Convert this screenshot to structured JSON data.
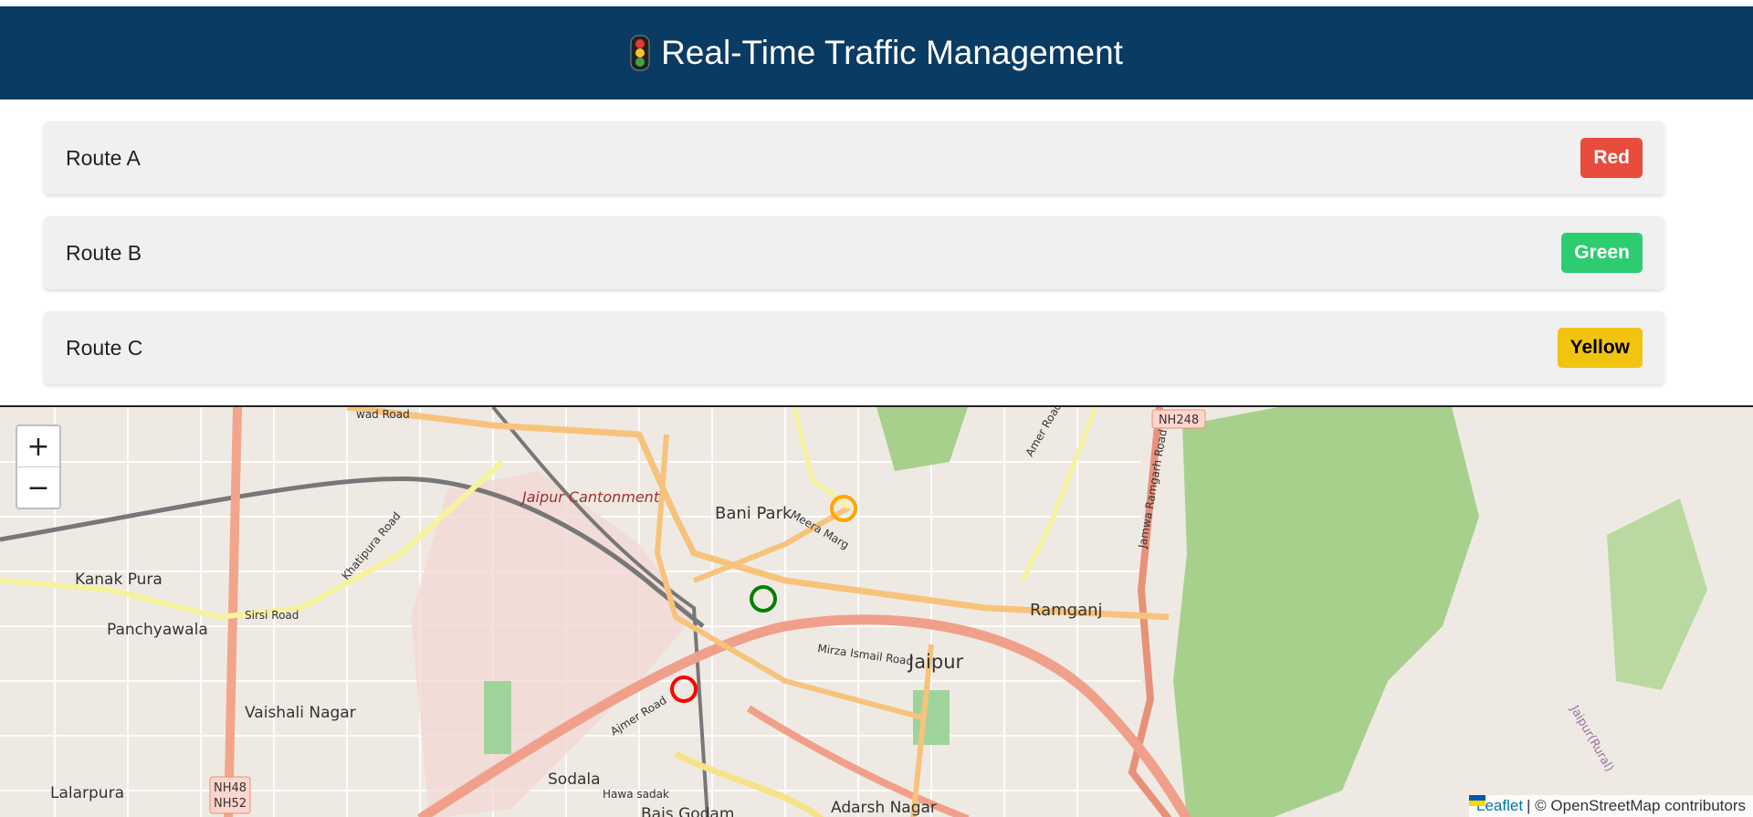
{
  "header": {
    "title": "Real-Time Traffic Management",
    "icon": "traffic-light-icon"
  },
  "routes": [
    {
      "name": "Route A",
      "status": "Red",
      "status_color": "#e74c3c"
    },
    {
      "name": "Route B",
      "status": "Green",
      "status_color": "#2ecc71"
    },
    {
      "name": "Route C",
      "status": "Yellow",
      "status_color": "#f1c40f"
    }
  ],
  "map": {
    "zoom_in": "+",
    "zoom_out": "−",
    "attribution_link": "Leaflet",
    "attribution_text": "| © OpenStreetMap contributors",
    "labels": {
      "bani_park": "Bani Park",
      "jaipur_cantonment": "Jaipur Cantonment",
      "kanak_pura": "Kanak Pura",
      "panchyawala": "Panchyawala",
      "vaishali_nagar": "Vaishali Nagar",
      "lalarpura": "Lalarpura",
      "ramganj": "Ramganj",
      "jaipur": "Jaipur",
      "sodala": "Sodala",
      "adarsh_nagar": "Adarsh Nagar",
      "bais_godam": "Bais Godam",
      "mirza_ismail_road": "Mirza Ismail Road",
      "ajmer_road": "Ajmer Road",
      "sirsi_road": "Sirsi Road",
      "khatipura_road": "Khatipura Road",
      "meera_marg": "Meera Marg",
      "amer_road": "Amer Road",
      "jamwa_ramgarh_road": "Jamwa Ramgarh Road",
      "hawa_sadak": "Hawa sadak",
      "jaipur_rural": "Jaipur(Rural)",
      "nh248": "NH248",
      "nh48": "NH48",
      "nh52": "NH52",
      "wad_road": "wad Road"
    },
    "markers": [
      {
        "color": "#ff0000"
      },
      {
        "color": "#008000"
      },
      {
        "color": "#ffa500"
      }
    ]
  }
}
